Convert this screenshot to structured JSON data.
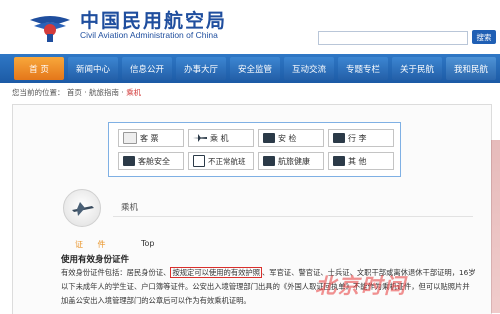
{
  "header": {
    "title_cn": "中国民用航空局",
    "title_en": "Civil Aviation Administration of China",
    "search_placeholder": "",
    "search_button": "搜索"
  },
  "nav": {
    "items": [
      {
        "label": "首 页"
      },
      {
        "label": "新闻中心"
      },
      {
        "label": "信息公开"
      },
      {
        "label": "办事大厅"
      },
      {
        "label": "安全监管"
      },
      {
        "label": "互动交流"
      },
      {
        "label": "专题专栏"
      },
      {
        "label": "关于民航"
      },
      {
        "label": "我和民航"
      }
    ]
  },
  "breadcrumb": {
    "prefix": "您当前的位置： 首页 · 航旅指南 · ",
    "current": "乘机"
  },
  "categories": [
    {
      "label": "客  票",
      "icon": "ticket-icon"
    },
    {
      "label": "乘  机",
      "icon": "plane-icon"
    },
    {
      "label": "安  检",
      "icon": "security-check-icon"
    },
    {
      "label": "行  李",
      "icon": "luggage-icon"
    },
    {
      "label": "客舱安全",
      "icon": "cabin-safety-icon"
    },
    {
      "label": "不正常航班",
      "icon": "flight-disruption-icon"
    },
    {
      "label": "航旅健康",
      "icon": "health-icon"
    },
    {
      "label": "其  他",
      "icon": "other-icon"
    }
  ],
  "section": {
    "title": "乘机",
    "doc_label": "证  件",
    "top_link": "Top",
    "heading": "使用有效身份证件",
    "line1_a": "有效身份证件包括：居民身份证、",
    "line1_highlight": "按规定可以使用的有效护照",
    "line1_b": "、军官证、警官证、士兵证、文职干部或离休退休干部证明，16岁",
    "line2": "以下未成年人的学生证、户口簿等证件。公安出入境管理部门出具的《外国人取证回执单》不能作为乘机证件，但可以贴照片并",
    "line3": "加盖公安出入境管理部门的公章后可以作为有效乘机证明。"
  },
  "watermark": "北京时间"
}
